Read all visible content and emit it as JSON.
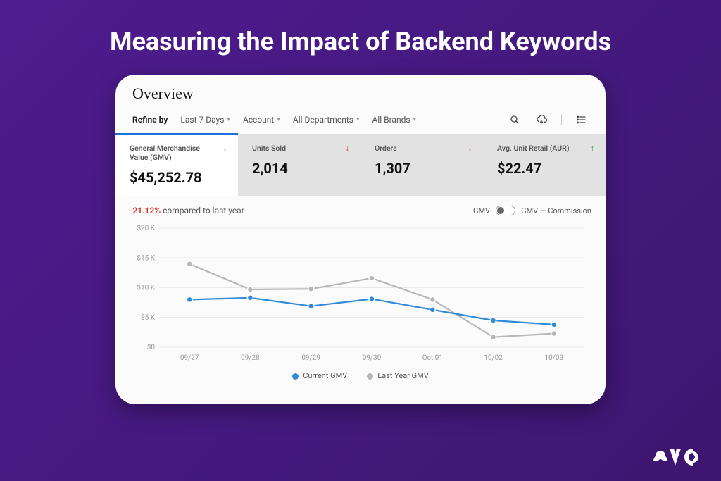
{
  "hero_title": "Measuring the Impact of Backend Keywords",
  "overview_title": "Overview",
  "refine": {
    "label": "Refine by",
    "items": [
      "Last 7 Days",
      "Account",
      "All Departments",
      "All Brands"
    ]
  },
  "kpis": [
    {
      "title": "General Merchandise Value (GMV)",
      "value": "$45,252.78",
      "trend": "down",
      "active": true
    },
    {
      "title": "Units Sold",
      "value": "2,014",
      "trend": "down",
      "active": false
    },
    {
      "title": "Orders",
      "value": "1,307",
      "trend": "down",
      "active": false
    },
    {
      "title": "Avg. Unit Retail (AUR)",
      "value": "$22.47",
      "trend": "up",
      "active": false
    }
  ],
  "comparison": {
    "delta": "-21.12%",
    "suffix": " compared to last year"
  },
  "toggle": {
    "left": "GMV",
    "right": "GMV — Commission"
  },
  "legend": {
    "current": "Current GMV",
    "last": "Last Year GMV"
  },
  "brand": "eva",
  "chart_data": {
    "type": "line",
    "title": "",
    "xlabel": "",
    "ylabel": "",
    "ylim": [
      0,
      20000
    ],
    "ytick_labels": [
      "$0",
      "$5 K",
      "$10 K",
      "$15 K",
      "$20 K"
    ],
    "categories": [
      "09/27",
      "09/28",
      "09/29",
      "09/30",
      "Oct 01",
      "10/02",
      "10/03"
    ],
    "series": [
      {
        "name": "Current GMV",
        "values": [
          8000,
          8300,
          6900,
          8100,
          6300,
          4500,
          3800
        ]
      },
      {
        "name": "Last Year GMV",
        "values": [
          14000,
          9700,
          9800,
          11600,
          8000,
          1700,
          2300
        ]
      }
    ]
  }
}
